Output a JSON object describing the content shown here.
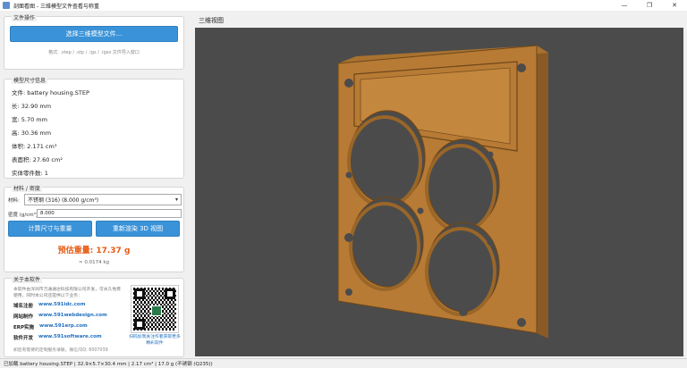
{
  "window": {
    "title": "剖面看图 - 三维模型文件查看与称重",
    "controls": {
      "minimize": "—",
      "maximize": "❐",
      "close": "✕"
    }
  },
  "file_ops": {
    "group_title": "文件操作",
    "select_button": "选择三维模型文件...",
    "hint": "格式: .step / .stp / .igs / .iges 文件导入窗口"
  },
  "info": {
    "group_title": "模型尺寸信息",
    "file": "文件: battery housing.STEP",
    "length": "长: 32.90 mm",
    "width": "宽: 5.70 mm",
    "height": "高: 30.36 mm",
    "volume": "体积: 2.171 cm³",
    "area": "表面积: 27.60 cm²",
    "parts": "实体零件数: 1"
  },
  "material": {
    "group_title": "材料 / 密度",
    "material_label": "材料:",
    "material_value": "不锈钢 (316) (8.000 g/cm³)",
    "density_label": "密度 (g/cm³):",
    "density_value": "8.000",
    "calc_button": "计算尺寸与重量",
    "render_button": "重新渲染 3D 视图",
    "weight": "预估重量: 17.37 g",
    "weight_kg": "≈ 0.0174 kg"
  },
  "about": {
    "group_title": "关于本软件",
    "desc": "本软件由深圳市万通通达科技有限公司开发，可永久免费使用，同时本公司还提供以下业务：",
    "rows": [
      {
        "key": "域名注册",
        "link": "www.591idc.com"
      },
      {
        "key": "网站制作",
        "link": "www.591webdesign.com"
      },
      {
        "key": "ERP实施",
        "link": "www.591erp.com"
      },
      {
        "key": "软件开发",
        "link": "www.591software.com"
      }
    ],
    "footer": "如您有需要的定制服务请联，微信/QQ: 6007039",
    "qr_caption": "扫码加我关注作者获取更多 精彩软件"
  },
  "viewport": {
    "title": "三维视图",
    "background": "#4b4b4b",
    "model_color": "#b77b35"
  },
  "status": {
    "text": "已加载 battery housing.STEP | 32.9×5.7×30.4 mm | 2.17 cm³ | 17.0 g (不锈钢 (Q235))"
  }
}
